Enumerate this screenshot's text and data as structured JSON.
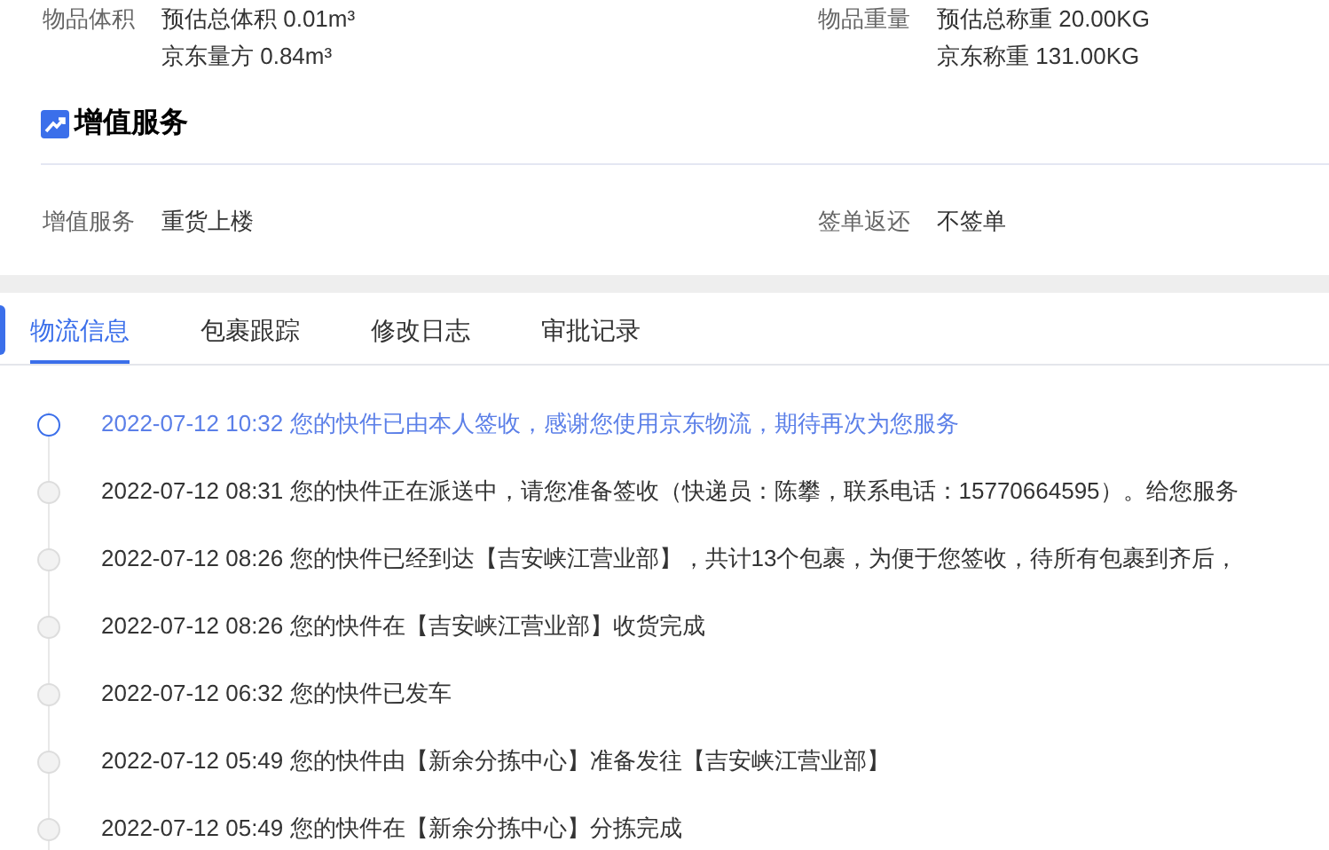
{
  "details": [
    {
      "label": "物品体积",
      "values": [
        "预估总体积 0.01m³",
        "京东量方 0.84m³"
      ]
    },
    {
      "label": "物品重量",
      "values": [
        "预估总称重 20.00KG",
        "京东称重 131.00KG"
      ]
    }
  ],
  "value_added": {
    "title": "增值服务",
    "fields": [
      {
        "label": "增值服务",
        "value": "重货上楼"
      },
      {
        "label": "签单返还",
        "value": "不签单"
      }
    ]
  },
  "tabs": [
    {
      "label": "物流信息",
      "selected": true
    },
    {
      "label": "包裹跟踪",
      "selected": false
    },
    {
      "label": "修改日志",
      "selected": false
    },
    {
      "label": "审批记录",
      "selected": false
    }
  ],
  "timeline": [
    {
      "text": "2022-07-12 10:32 您的快件已由本人签收，感谢您使用京东物流，期待再次为您服务",
      "current": true
    },
    {
      "text": "2022-07-12 08:31 您的快件正在派送中，请您准备签收（快递员：陈攀，联系电话：15770664595）。给您服务",
      "current": false
    },
    {
      "text": "2022-07-12 08:26 您的快件已经到达【吉安峡江营业部】，共计13个包裹，为便于您签收，待所有包裹到齐后，",
      "current": false
    },
    {
      "text": "2022-07-12 08:26 您的快件在【吉安峡江营业部】收货完成",
      "current": false
    },
    {
      "text": "2022-07-12 06:32 您的快件已发车",
      "current": false
    },
    {
      "text": "2022-07-12 05:49 您的快件由【新余分拣中心】准备发往【吉安峡江营业部】",
      "current": false
    },
    {
      "text": "2022-07-12 05:49 您的快件在【新余分拣中心】分拣完成",
      "current": false
    }
  ]
}
